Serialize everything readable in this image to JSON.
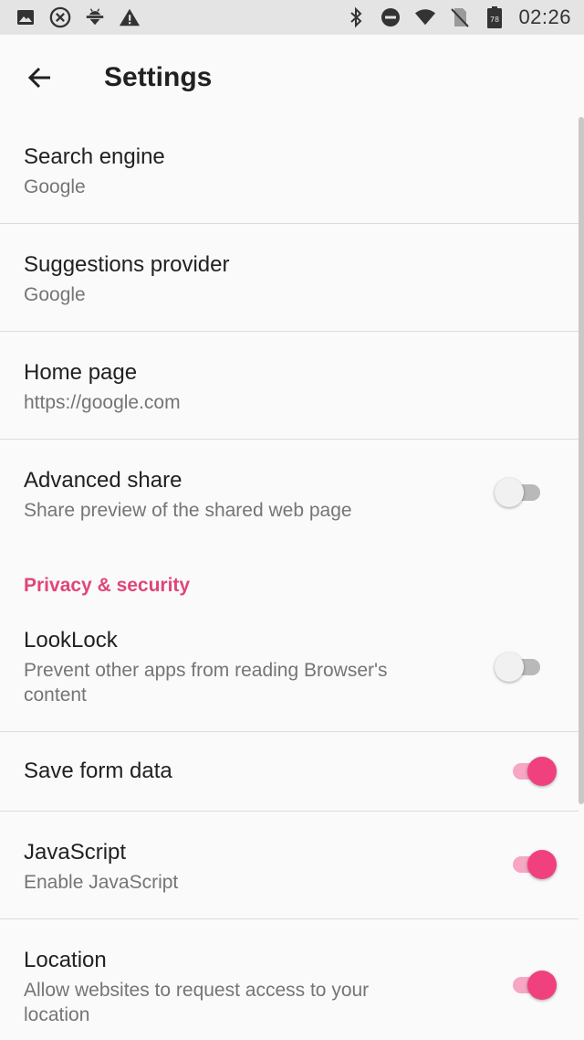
{
  "status_bar": {
    "time": "02:26",
    "battery_level": "78",
    "left_icons": [
      "image-icon",
      "x-circle-icon",
      "android-download-icon",
      "warning-icon"
    ],
    "right_icons": [
      "bluetooth-icon",
      "do-not-disturb-icon",
      "wifi-icon",
      "no-sim-icon",
      "battery-icon"
    ]
  },
  "app_bar": {
    "title": "Settings"
  },
  "settings": {
    "search_engine": {
      "title": "Search engine",
      "value": "Google"
    },
    "suggestions_provider": {
      "title": "Suggestions provider",
      "value": "Google"
    },
    "home_page": {
      "title": "Home page",
      "value": "https://google.com"
    },
    "advanced_share": {
      "title": "Advanced share",
      "summary": "Share preview of the shared web page",
      "enabled": false
    },
    "privacy_section": {
      "label": "Privacy & security"
    },
    "looklock": {
      "title": "LookLock",
      "summary_line1": "Prevent other apps from reading Browser's",
      "summary_line2": "content",
      "enabled": false
    },
    "save_form_data": {
      "title": "Save form data",
      "enabled": true
    },
    "javascript": {
      "title": "JavaScript",
      "summary": "Enable JavaScript",
      "enabled": true
    },
    "location": {
      "title": "Location",
      "summary_line1": "Allow websites to request access to your",
      "summary_line2": "location",
      "enabled": true
    }
  },
  "colors": {
    "accent": "#e0457b",
    "switch_on_thumb": "#f0417e",
    "switch_on_track": "#f7a6c4",
    "switch_off_thumb": "#f1f1f1",
    "switch_off_track": "#b9b9b9",
    "status_bar_bg": "#e4e4e4",
    "background": "#fafafa"
  }
}
